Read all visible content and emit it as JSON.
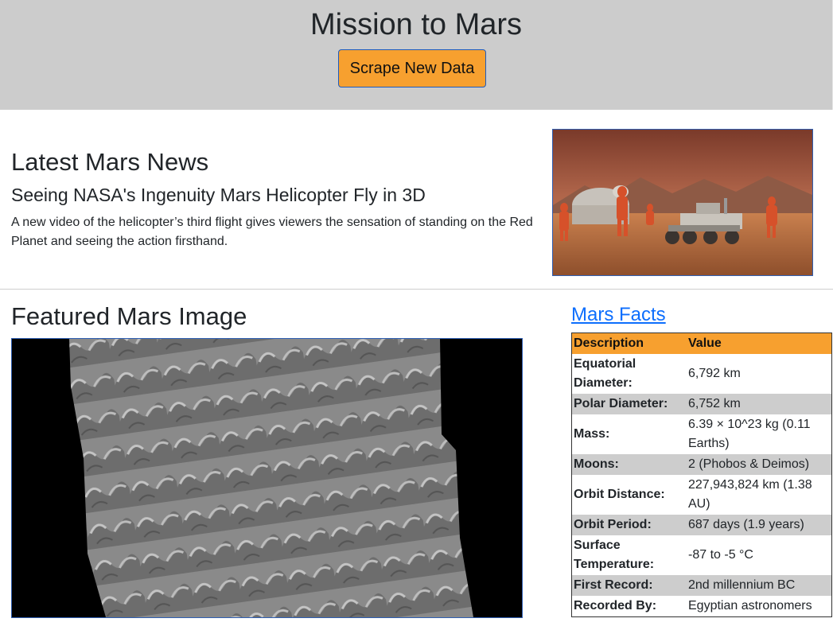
{
  "header": {
    "title": "Mission to Mars",
    "scrape_button": "Scrape New Data"
  },
  "news": {
    "heading": "Latest Mars News",
    "title": "Seeing NASA's Ingenuity Mars Helicopter Fly in 3D",
    "teaser": "A new video of the helicopter’s third flight gives viewers the sensation of standing on the Red Planet and seeing the action firsthand."
  },
  "featured": {
    "heading": "Featured Mars Image"
  },
  "facts": {
    "link_label": "Mars Facts",
    "columns": [
      "Description",
      "Value"
    ],
    "rows": [
      {
        "desc": "Equatorial Diameter:",
        "value": "6,792 km"
      },
      {
        "desc": "Polar Diameter:",
        "value": "6,752 km"
      },
      {
        "desc": "Mass:",
        "value": "6.39 × 10^23 kg (0.11 Earths)"
      },
      {
        "desc": "Moons:",
        "value": "2 (Phobos & Deimos)"
      },
      {
        "desc": "Orbit Distance:",
        "value": "227,943,824 km (1.38 AU)"
      },
      {
        "desc": "Orbit Period:",
        "value": "687 days (1.9 years)"
      },
      {
        "desc": "Surface Temperature:",
        "value": "-87 to -5 °C"
      },
      {
        "desc": "First Record:",
        "value": "2nd millennium BC"
      },
      {
        "desc": "Recorded By:",
        "value": "Egyptian astronomers"
      }
    ]
  },
  "colors": {
    "jumbotron_bg": "#cccccc",
    "accent_orange": "#f7a02f",
    "link_blue": "#0d6efd",
    "row_alt": "#cdcdcd"
  }
}
